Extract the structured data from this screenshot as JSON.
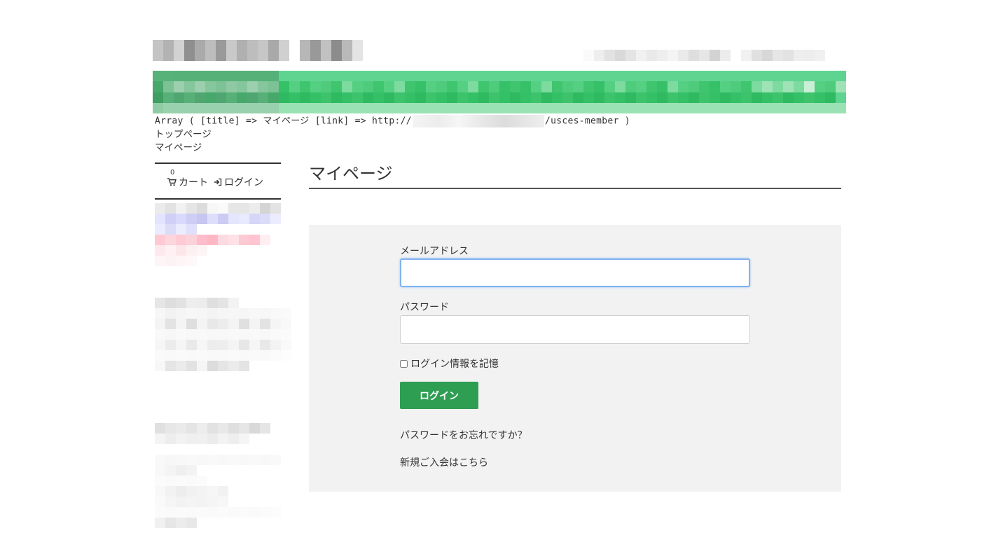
{
  "colors": {
    "accent_green": "#2e9e52",
    "nav_green": "#3cc873",
    "panel_bg": "#f2f2f2",
    "focus_blue": "#7fb3f0"
  },
  "breadcrumb_debug": {
    "prefix": "Array ( [title] => マイページ [link] => http://",
    "suffix": "/usces-member )"
  },
  "breadcrumb": {
    "top": "トップページ",
    "current": "マイページ"
  },
  "cart_widget": {
    "count": "0",
    "cart_label": "カート",
    "login_label": "ログイン",
    "cart_icon": "cart-icon",
    "login_icon": "sign-in-icon"
  },
  "page": {
    "title": "マイページ"
  },
  "login_form": {
    "email_label": "メールアドレス",
    "email_value": "",
    "password_label": "パスワード",
    "password_value": "",
    "remember_label": "ログイン情報を記憶",
    "remember_checked": false,
    "submit_label": "ログイン",
    "forgot_link": "パスワードをお忘れですか？",
    "register_link": "新規ご入会はこちら"
  }
}
